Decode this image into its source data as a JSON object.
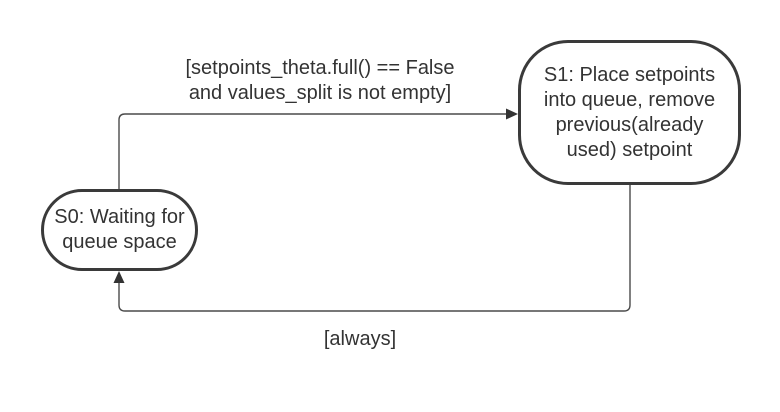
{
  "states": {
    "s0": {
      "label": "S0: Waiting for\nqueue space"
    },
    "s1": {
      "label": "S1: Place setpoints\ninto queue, remove\nprevious(already\nused) setpoint"
    }
  },
  "transitions": {
    "s0_to_s1": {
      "label": "[setpoints_theta.full() == False\nand values_split is not empty]"
    },
    "s1_to_s0": {
      "label": "[always]"
    }
  },
  "colors": {
    "stroke": "#3a3a3a",
    "connector": "#4a4a4a",
    "text": "#333333"
  }
}
